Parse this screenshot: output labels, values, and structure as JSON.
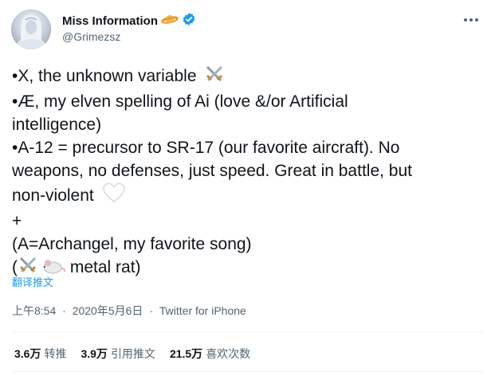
{
  "author": {
    "display_name": "Miss Information",
    "handle": "@Grimezsz",
    "badges": [
      "planet-icon",
      "verified-badge-icon"
    ],
    "verified_color": "#1d9bf0"
  },
  "tweet": {
    "lines": [
      "•X, the unknown variable",
      "•Æ, my elven spelling of Ai (love &/or Artificial",
      "intelligence)",
      "•A-12 = precursor to SR-17 (our favorite aircraft).  No",
      "weapons, no defenses, just speed.  Great in battle, but",
      "non-violent",
      "+",
      "(A=Archangel, my favorite song)",
      "metal rat)"
    ],
    "line9_prefix": "(",
    "emoji": {
      "line1_end": "crossed-swords-icon",
      "line6_end": "white-heart-icon",
      "line9_start": [
        "crossed-swords-icon",
        "mouse-icon"
      ]
    },
    "translate_label": "翻译推文"
  },
  "meta": {
    "time": "上午8:54",
    "date": "2020年5月6日",
    "source": "Twitter for iPhone",
    "separator": "·"
  },
  "stats": [
    {
      "count": "3.6万",
      "label": "转推"
    },
    {
      "count": "3.9万",
      "label": "引用推文"
    },
    {
      "count": "21.5万",
      "label": "喜欢次数"
    }
  ]
}
